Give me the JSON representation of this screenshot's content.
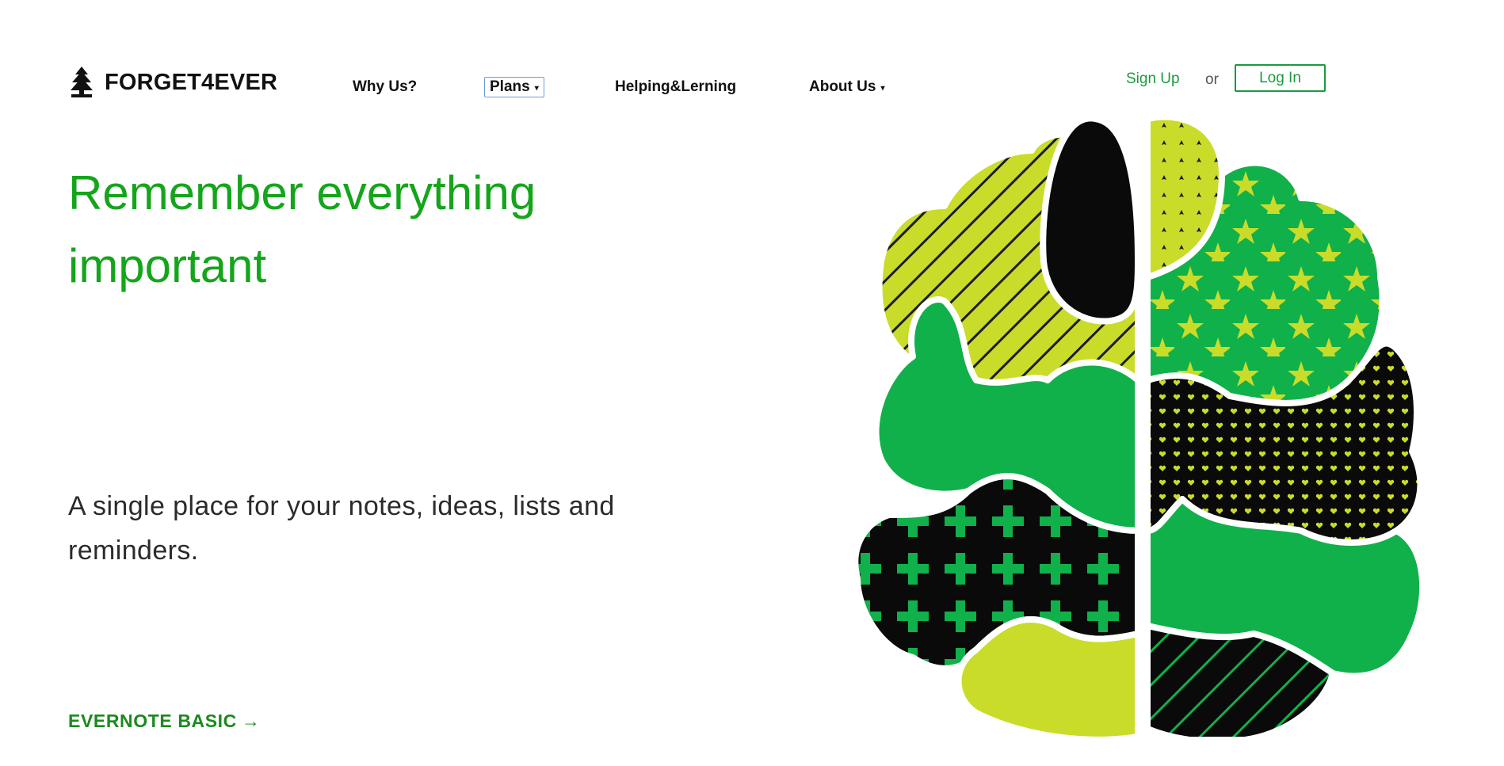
{
  "brand": {
    "name": "FORGET4EVER",
    "icon": "tree-icon"
  },
  "nav": {
    "why_us": "Why Us?",
    "plans": "Plans",
    "helping": "Helping&Lerning",
    "about_us": "About Us",
    "caret": "▾"
  },
  "auth": {
    "signup": "Sign Up",
    "or": "or",
    "login": "Log In"
  },
  "hero": {
    "headline": "Remember everything important",
    "subtitle": "A single place for your notes, ideas, lists and reminders.",
    "cta": "EVERNOTE BASIC",
    "cta_arrow": "→"
  },
  "colors": {
    "brand_green": "#14a51b",
    "link_green": "#1a9b3f",
    "lime": "#c9dc2a",
    "mid_green": "#10b04a"
  }
}
